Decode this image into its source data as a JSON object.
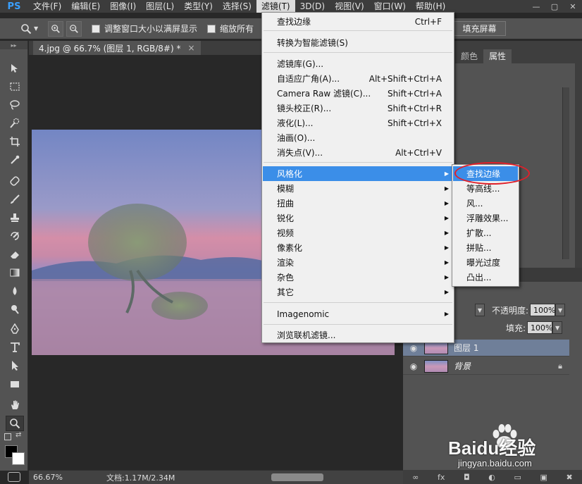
{
  "app": {
    "logo": "PS"
  },
  "menubar": {
    "items": [
      "文件(F)",
      "编辑(E)",
      "图像(I)",
      "图层(L)",
      "类型(Y)",
      "选择(S)",
      "滤镜(T)",
      "3D(D)",
      "视图(V)",
      "窗口(W)",
      "帮助(H)"
    ],
    "active_index": 6
  },
  "window_controls": [
    "—",
    "▢",
    "✕"
  ],
  "options_bar": {
    "resize_window_label": "调整窗口大小以满屏显示",
    "zoom_all_label": "缩放所有",
    "fill_screen_label": "填充屏幕"
  },
  "document": {
    "tab_title": "4.jpg @ 66.7% (图层 1, RGB/8#) *",
    "close": "×"
  },
  "filter_menu": {
    "items": [
      {
        "label": "查找边缘",
        "shortcut": "Ctrl+F"
      },
      {
        "label": "转换为智能滤镜(S)",
        "shortcut": ""
      },
      {
        "label": "滤镜库(G)...",
        "shortcut": ""
      },
      {
        "label": "自适应广角(A)...",
        "shortcut": "Alt+Shift+Ctrl+A"
      },
      {
        "label": "Camera Raw 滤镜(C)...",
        "shortcut": "Shift+Ctrl+A"
      },
      {
        "label": "镜头校正(R)...",
        "shortcut": "Shift+Ctrl+R"
      },
      {
        "label": "液化(L)...",
        "shortcut": "Shift+Ctrl+X"
      },
      {
        "label": "油画(O)...",
        "shortcut": ""
      },
      {
        "label": "消失点(V)...",
        "shortcut": "Alt+Ctrl+V"
      },
      {
        "label": "风格化",
        "submenu": true
      },
      {
        "label": "模糊",
        "submenu": true
      },
      {
        "label": "扭曲",
        "submenu": true
      },
      {
        "label": "锐化",
        "submenu": true
      },
      {
        "label": "视频",
        "submenu": true
      },
      {
        "label": "像素化",
        "submenu": true
      },
      {
        "label": "渲染",
        "submenu": true
      },
      {
        "label": "杂色",
        "submenu": true
      },
      {
        "label": "其它",
        "submenu": true
      },
      {
        "label": "Imagenomic",
        "submenu": true
      },
      {
        "label": "浏览联机滤镜...",
        "shortcut": ""
      }
    ],
    "highlight_index": 9
  },
  "stylize_submenu": {
    "items": [
      "查找边缘",
      "等高线...",
      "风...",
      "浮雕效果...",
      "扩散...",
      "拼贴...",
      "曝光过度",
      "凸出..."
    ],
    "highlight_index": 0
  },
  "panels": {
    "tabs": [
      "颜色",
      "属性"
    ],
    "active_tab_index": 1
  },
  "layers": {
    "opacity_label": "不透明度:",
    "opacity_value": "100%",
    "fill_label": "填充:",
    "fill_value": "100%",
    "rows": [
      {
        "name": "图层 1",
        "selected": true
      },
      {
        "name": "背景",
        "selected": false,
        "locked": true
      }
    ]
  },
  "statusbar": {
    "zoom": "66.67%",
    "doc_size": "文档:1.17M/2.34M"
  },
  "watermark": {
    "brand": "Baidu经验",
    "url": "jingyan.baidu.com"
  },
  "colors": {
    "menu_highlight": "#3b8ee8",
    "annotation_ring": "#e0202a",
    "ps_blue": "#3aa0ff"
  }
}
